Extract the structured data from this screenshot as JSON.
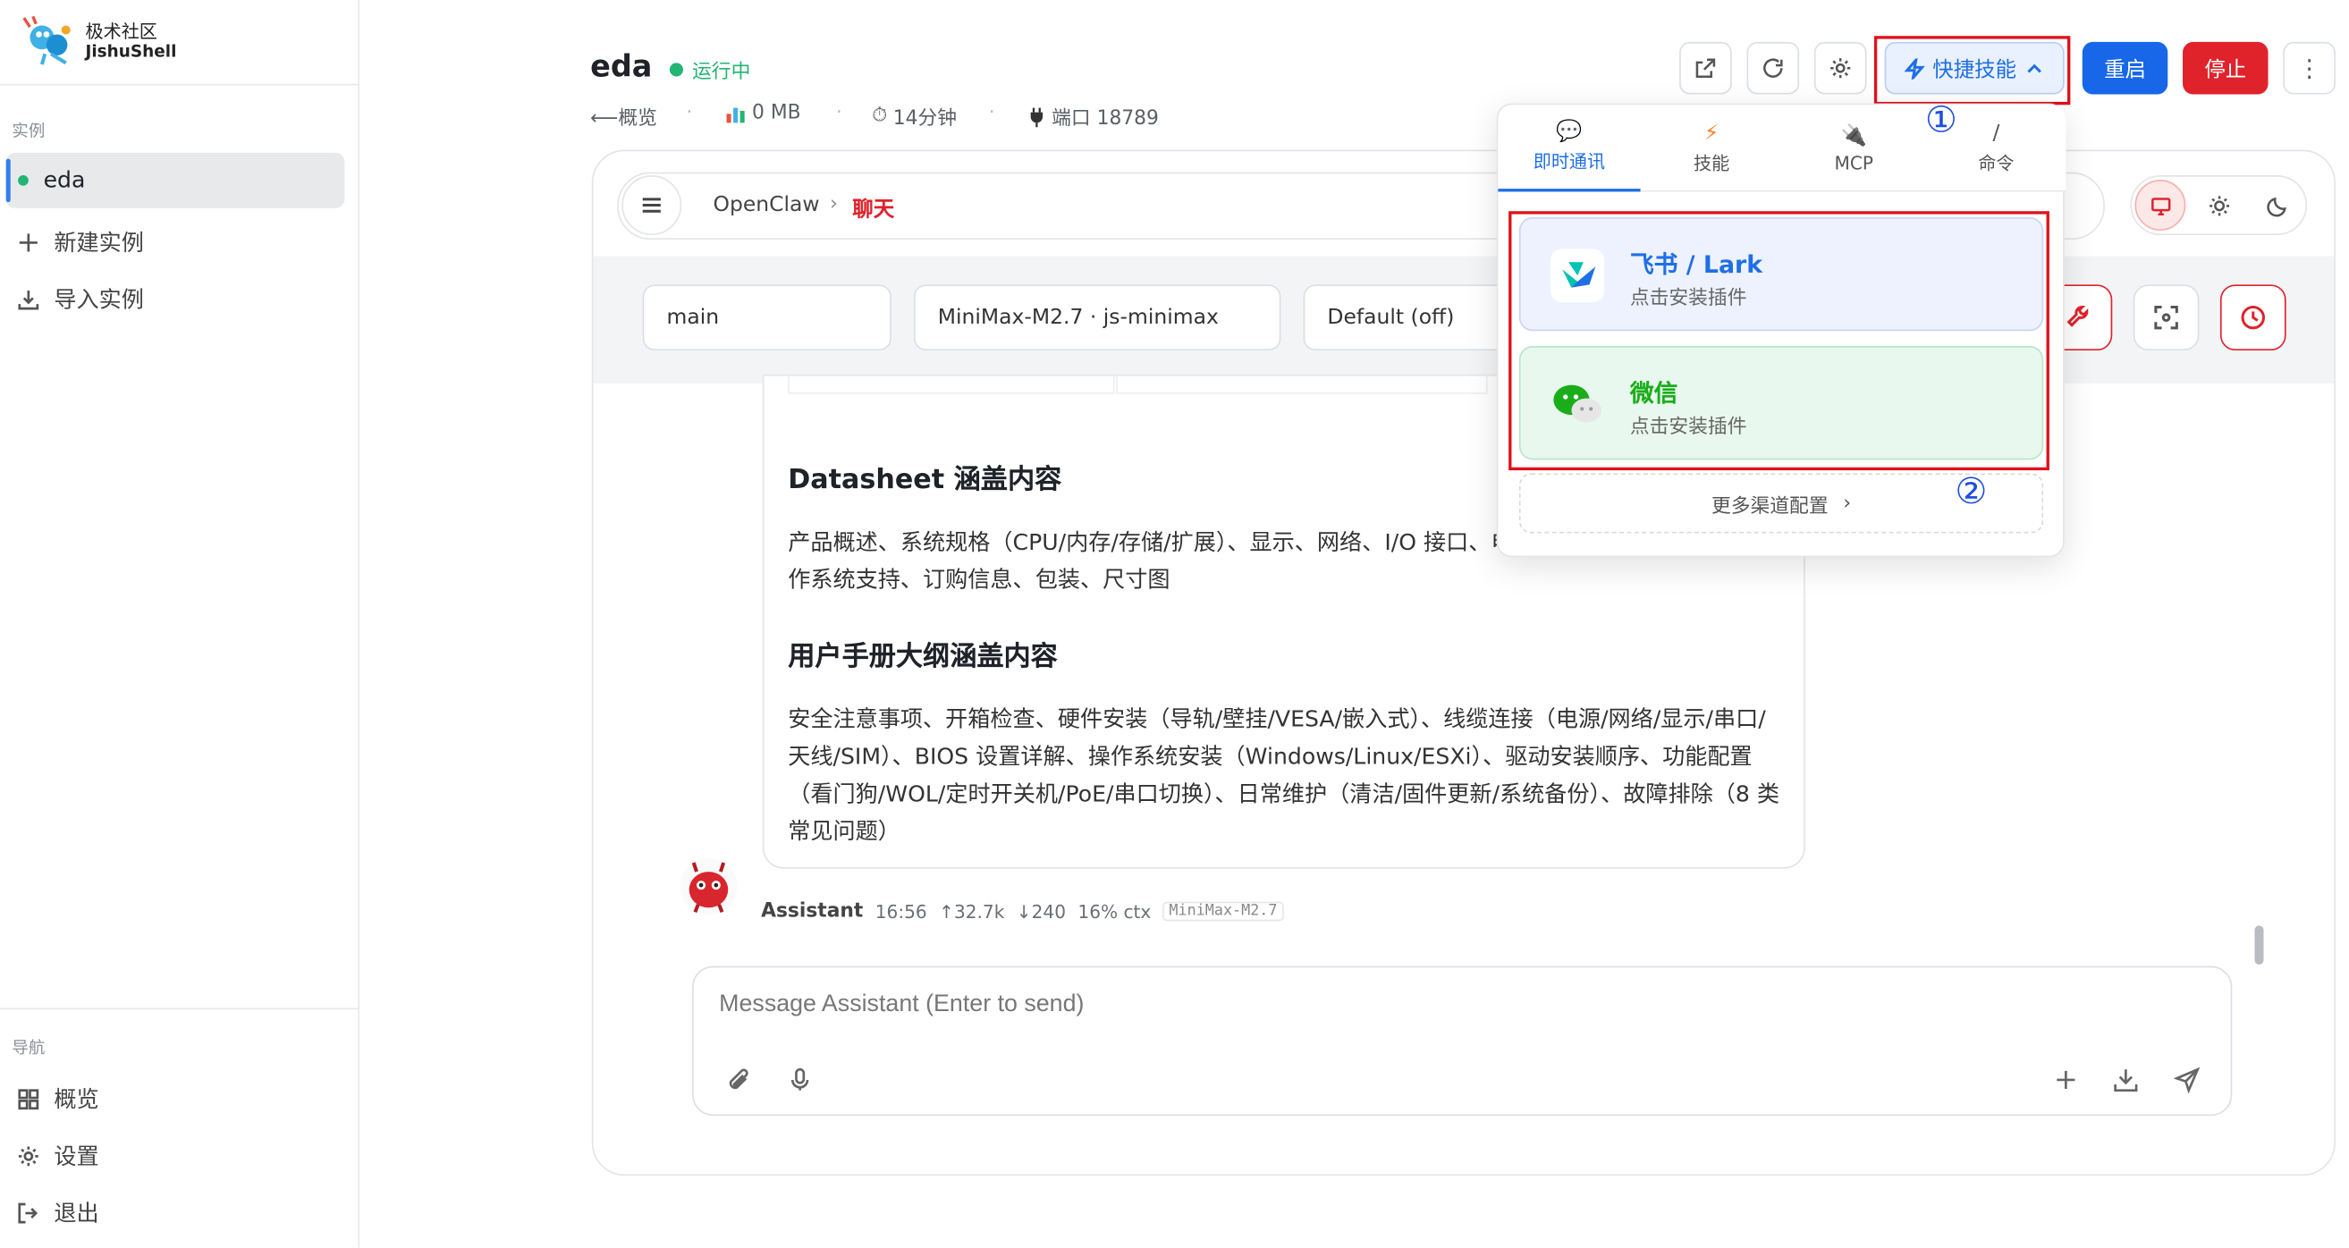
{
  "brand": {
    "line1": "极术社区",
    "line2": "JishuShell"
  },
  "sidebar": {
    "instances_label": "实例",
    "instances": [
      {
        "name": "eda"
      }
    ],
    "new_instance": "新建实例",
    "import_instance": "导入实例",
    "nav_label": "导航",
    "nav": [
      {
        "label": "概览"
      },
      {
        "label": "设置"
      },
      {
        "label": "退出"
      }
    ]
  },
  "header": {
    "title": "eda",
    "status": "运行中",
    "back": "⟵概览",
    "memory": "0 MB",
    "uptime": "14分钟",
    "port": "端口 18789",
    "skill_button": "快捷技能",
    "restart": "重启",
    "stop": "停止",
    "more": "⋮"
  },
  "chat": {
    "breadcrumb_root": "OpenClaw",
    "breadcrumb_sep": "›",
    "breadcrumb_current": "聊天",
    "session": "main",
    "model": "MiniMax-M2.7 · js-minimax",
    "thinking": "Default (off)"
  },
  "message": {
    "h1": "Datasheet 涵盖内容",
    "p1": "产品概述、系统规格（CPU/内存/存储/扩展）、显示、网络、I/O 接口、电源规格、认证、可靠性、操作系统支持、订购信息、包装、尺寸图",
    "h2": "用户手册大纲涵盖内容",
    "p2": "安全注意事项、开箱检查、硬件安装（导轨/壁挂/VESA/嵌入式）、线缆连接（电源/网络/显示/串口/天线/SIM）、BIOS 设置详解、操作系统安装（Windows/Linux/ESXi）、驱动安装顺序、功能配置（看门狗/WOL/定时开关机/PoE/串口切换）、日常维护（清洁/固件更新/系统备份）、故障排除（8 类常见问题）",
    "author": "Assistant",
    "time": "16:56",
    "tokens_in": "↑32.7k",
    "tokens_out": "↓240",
    "ctx": "16% ctx",
    "model_tag": "MiniMax-M2.7"
  },
  "composer": {
    "placeholder": "Message Assistant (Enter to send)"
  },
  "dropdown": {
    "tabs": [
      {
        "label": "即时通讯",
        "icon": "chat-bubble-icon"
      },
      {
        "label": "技能",
        "icon": "bolt-icon"
      },
      {
        "label": "MCP",
        "icon": "plug-icon"
      },
      {
        "label": "命令",
        "icon": "slash-icon"
      }
    ],
    "slash": "/",
    "channels": [
      {
        "title": "飞书 / Lark",
        "subtitle": "点击安装插件",
        "color": "#1f6fe5"
      },
      {
        "title": "微信",
        "subtitle": "点击安装插件",
        "color": "#1aad19"
      }
    ],
    "more": "更多渠道配置",
    "more_arrow": "›"
  },
  "annotations": {
    "one": "①",
    "two": "②"
  },
  "colors": {
    "accent": "#1767e8",
    "danger": "#e0222b",
    "success": "#22b573",
    "highlight": "#e0111b"
  }
}
